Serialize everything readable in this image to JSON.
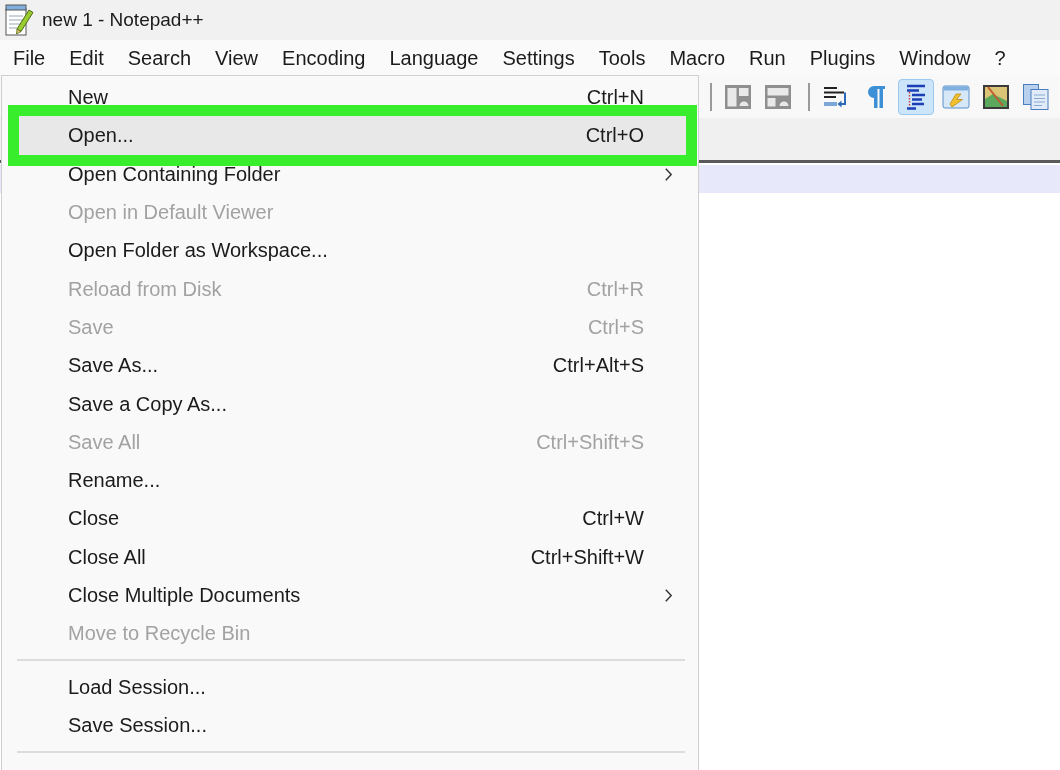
{
  "window": {
    "title": "new 1 - Notepad++"
  },
  "menu_bar": [
    "File",
    "Edit",
    "Search",
    "View",
    "Encoding",
    "Language",
    "Settings",
    "Tools",
    "Macro",
    "Run",
    "Plugins",
    "Window",
    "?"
  ],
  "toolbar": [
    {
      "kind": "separator"
    },
    {
      "kind": "sync-vertical",
      "pressed": false
    },
    {
      "kind": "sync-horizontal",
      "pressed": false
    },
    {
      "kind": "separator"
    },
    {
      "kind": "word-wrap",
      "pressed": false
    },
    {
      "kind": "all-characters",
      "pressed": false
    },
    {
      "kind": "indent-guide",
      "pressed": true
    },
    {
      "kind": "user-language",
      "pressed": false
    },
    {
      "kind": "document-map",
      "pressed": false
    },
    {
      "kind": "document-list",
      "pressed": false
    }
  ],
  "file_menu": {
    "items": [
      {
        "kind": "item",
        "label": "New",
        "shortcut": "Ctrl+N",
        "disabled": false,
        "selected": false,
        "highlighted": false,
        "submenu": false
      },
      {
        "kind": "item",
        "label": "Open...",
        "shortcut": "Ctrl+O",
        "disabled": false,
        "selected": true,
        "highlighted": true,
        "submenu": false
      },
      {
        "kind": "item",
        "label": "Open Containing Folder",
        "disabled": false,
        "selected": false,
        "highlighted": false,
        "submenu": true
      },
      {
        "kind": "item",
        "label": "Open in Default Viewer",
        "disabled": true,
        "selected": false,
        "highlighted": false,
        "submenu": false
      },
      {
        "kind": "item",
        "label": "Open Folder as Workspace...",
        "disabled": false,
        "selected": false,
        "highlighted": false,
        "submenu": false
      },
      {
        "kind": "item",
        "label": "Reload from Disk",
        "shortcut": "Ctrl+R",
        "disabled": true,
        "selected": false,
        "highlighted": false,
        "submenu": false
      },
      {
        "kind": "item",
        "label": "Save",
        "shortcut": "Ctrl+S",
        "disabled": true,
        "selected": false,
        "highlighted": false,
        "submenu": false
      },
      {
        "kind": "item",
        "label": "Save As...",
        "shortcut": "Ctrl+Alt+S",
        "disabled": false,
        "selected": false,
        "highlighted": false,
        "submenu": false
      },
      {
        "kind": "item",
        "label": "Save a Copy As...",
        "disabled": false,
        "selected": false,
        "highlighted": false,
        "submenu": false
      },
      {
        "kind": "item",
        "label": "Save All",
        "shortcut": "Ctrl+Shift+S",
        "disabled": true,
        "selected": false,
        "highlighted": false,
        "submenu": false
      },
      {
        "kind": "item",
        "label": "Rename...",
        "disabled": false,
        "selected": false,
        "highlighted": false,
        "submenu": false
      },
      {
        "kind": "item",
        "label": "Close",
        "shortcut": "Ctrl+W",
        "disabled": false,
        "selected": false,
        "highlighted": false,
        "submenu": false
      },
      {
        "kind": "item",
        "label": "Close All",
        "shortcut": "Ctrl+Shift+W",
        "disabled": false,
        "selected": false,
        "highlighted": false,
        "submenu": false
      },
      {
        "kind": "item",
        "label": "Close Multiple Documents",
        "disabled": false,
        "selected": false,
        "highlighted": false,
        "submenu": true
      },
      {
        "kind": "item",
        "label": "Move to Recycle Bin",
        "disabled": true,
        "selected": false,
        "highlighted": false,
        "submenu": false
      },
      {
        "kind": "separator"
      },
      {
        "kind": "item",
        "label": "Load Session...",
        "disabled": false,
        "selected": false,
        "highlighted": false,
        "submenu": false
      },
      {
        "kind": "item",
        "label": "Save Session...",
        "disabled": false,
        "selected": false,
        "highlighted": false,
        "submenu": false
      },
      {
        "kind": "separator"
      }
    ]
  }
}
